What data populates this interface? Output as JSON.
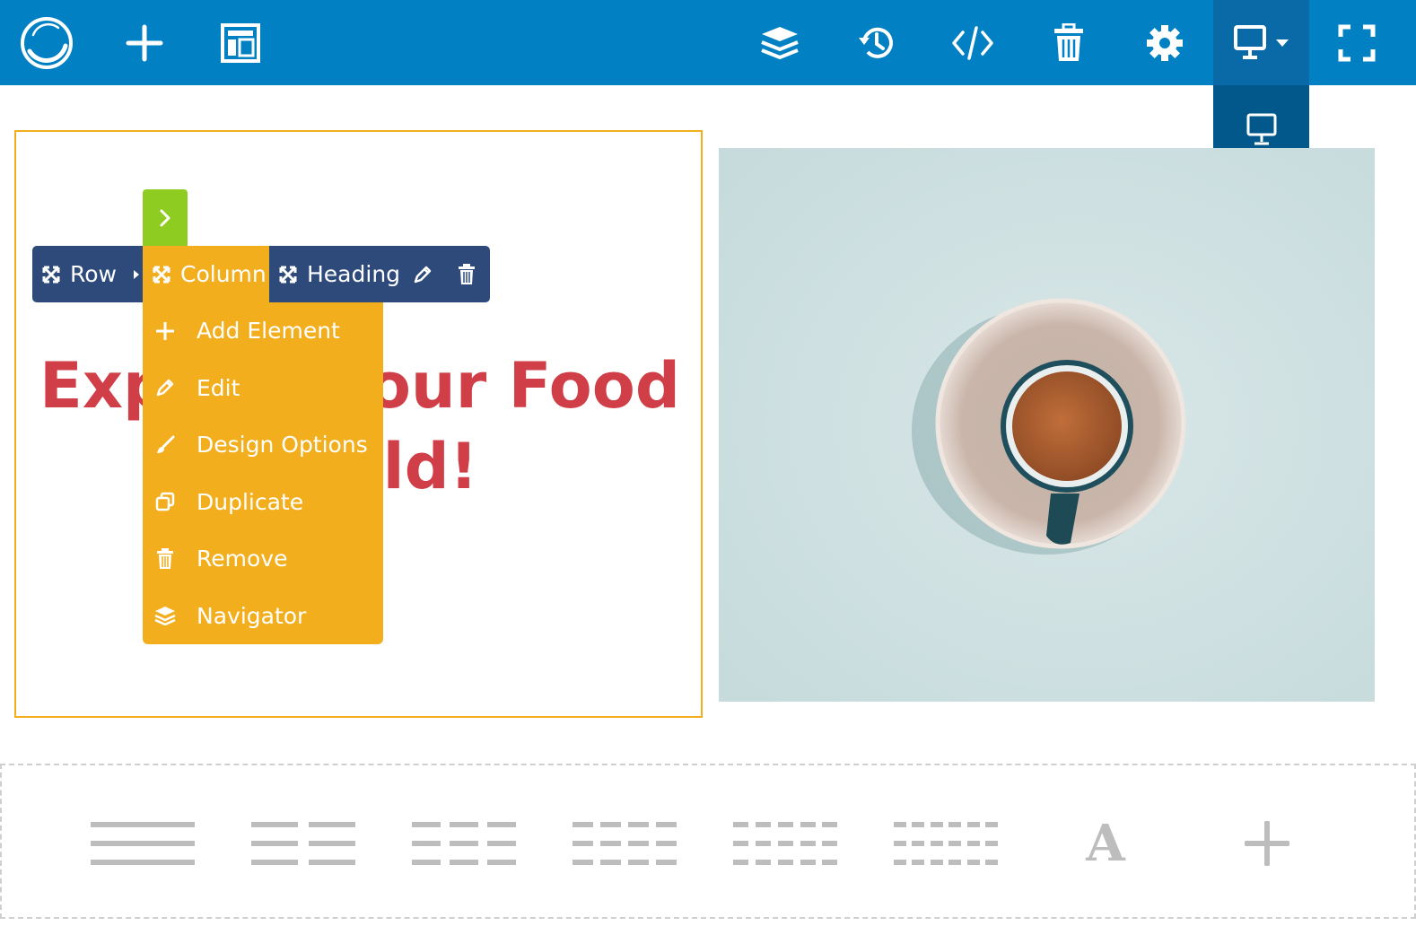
{
  "topbar": {
    "bg_color": "#0180c3",
    "left_icons": [
      "logo-icon",
      "plus-icon",
      "layout-icon"
    ],
    "right_icons": [
      "layers-icon",
      "history-icon",
      "code-icon",
      "trash-icon",
      "gear-icon",
      "desktop-icon",
      "fullscreen-icon"
    ]
  },
  "device_dropdown": {
    "items": [
      "desktop-icon",
      "tablet-landscape-icon",
      "tablet-portrait-icon",
      "mobile-landscape-icon",
      "mobile-portrait-icon"
    ],
    "selected": "desktop-icon"
  },
  "canvas": {
    "heading_line1": "Explore Your Food",
    "heading_line2": "World!",
    "heading_color": "#d03f47"
  },
  "breadcrumb": {
    "row": "Row",
    "column": "Column",
    "heading": "Heading"
  },
  "column_menu": {
    "items": [
      {
        "label": "Add Element",
        "icon": "plus-icon"
      },
      {
        "label": "Edit",
        "icon": "pencil-icon"
      },
      {
        "label": "Design Options",
        "icon": "brush-icon"
      },
      {
        "label": "Duplicate",
        "icon": "duplicate-icon"
      },
      {
        "label": "Remove",
        "icon": "trash-icon"
      },
      {
        "label": "Navigator",
        "icon": "layers-icon"
      }
    ]
  },
  "add_bar": {
    "layouts": [
      "1-column-layout-icon",
      "2-column-layout-icon",
      "3-column-layout-icon",
      "4-column-layout-icon",
      "5-column-layout-icon",
      "6-column-layout-icon",
      "text-element-icon",
      "add-element-icon"
    ],
    "text_glyph": "A"
  },
  "colors": {
    "accent_blue": "#0180c3",
    "dark_blue": "#2d4a7b",
    "amber": "#f2ae1c",
    "green": "#8fcc21",
    "heading_red": "#d03f47"
  }
}
